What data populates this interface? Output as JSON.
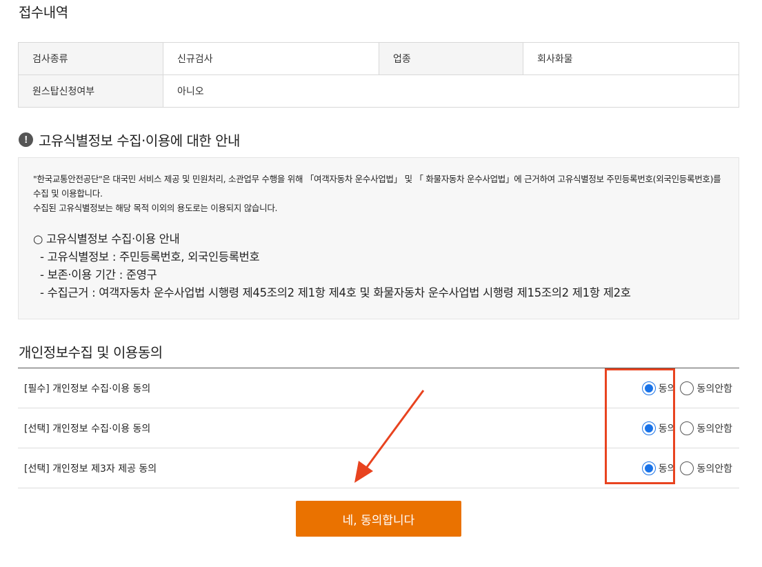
{
  "receipt": {
    "title": "접수내역",
    "rows": [
      [
        {
          "label": "검사종류",
          "value": "신규검사"
        },
        {
          "label": "업종",
          "value": "회사화물"
        }
      ],
      [
        {
          "label": "원스탑신청여부",
          "value": "아니오"
        }
      ]
    ]
  },
  "notice": {
    "icon": "!",
    "title": "고유식별정보 수집·이용에 대한 안내",
    "para1": "\"한국교통안전공단\"은 대국민 서비스 제공 및 민원처리, 소관업무 수행을 위해 「여객자동차 운수사업법」 및 「 화물자동차 운수사업법」에 근거하여 고유식별정보 주민등록번호(외국인등록번호)를 수집 및 이용합니다.",
    "para2": "수집된 고유식별정보는 해당 목적 이외의 용도로는 이용되지 않습니다.",
    "list_head": "○ 고유식별정보 수집·이용 안내",
    "list": [
      "- 고유식별정보 : 주민등록번호, 외국인등록번호",
      "- 보존·이용 기간 : 준영구",
      "- 수집근거 : 여객자동차 운수사업법 시행령 제45조의2 제1항 제4호 및 화물자동차 운수사업법 시행령 제15조의2 제1항 제2호"
    ]
  },
  "consent": {
    "title": "개인정보수집 및 이용동의",
    "agree_label": "동의",
    "disagree_label": "동의안함",
    "rows": [
      {
        "label": "[필수] 개인정보 수집·이용 동의",
        "selected": "agree"
      },
      {
        "label": "[선택] 개인정보 수집·이용 동의",
        "selected": "agree"
      },
      {
        "label": "[선택] 개인정보 제3자 제공 동의",
        "selected": "agree"
      }
    ]
  },
  "submit_label": "네, 동의합니다",
  "colors": {
    "button": "#ea7200",
    "radio_selected": "#1a73e8",
    "annotation": "#e8431f"
  }
}
